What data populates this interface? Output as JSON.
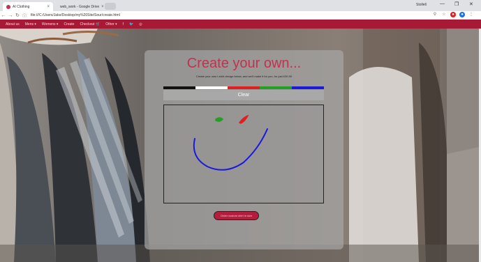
{
  "browser": {
    "tabs": [
      {
        "label": "AI Clothing",
        "active": true,
        "favicon_color": "#c1324e"
      },
      {
        "label": "web_work - Google Drive",
        "active": false,
        "favicon_color": "#4285f4"
      }
    ],
    "user_badge": "Stolle6",
    "window_controls": {
      "minimize": "—",
      "maximize": "❐",
      "close": "✕"
    },
    "address_url": "file:///C:/Users/Jake/Desktop/my%20Site/Sour/create.html"
  },
  "site_nav": {
    "items": [
      "About us",
      "Mens ▾",
      "Womens ▾",
      "Create",
      "Checkout 🛒",
      "Other ▾",
      "f",
      "🐦",
      "◎"
    ]
  },
  "panel": {
    "title": "Create your own...",
    "subtitle": "Create your own t-shirt design below, and we'll make it for you, for just £30.00",
    "palette_colors": [
      "#111111",
      "#ffffff",
      "#e02020",
      "#22a022",
      "#1a1adc"
    ],
    "clear_label": "Clear",
    "order_label": "Order custom shirt in size"
  },
  "colors": {
    "accent": "#a71a35",
    "title": "#c1324e"
  }
}
